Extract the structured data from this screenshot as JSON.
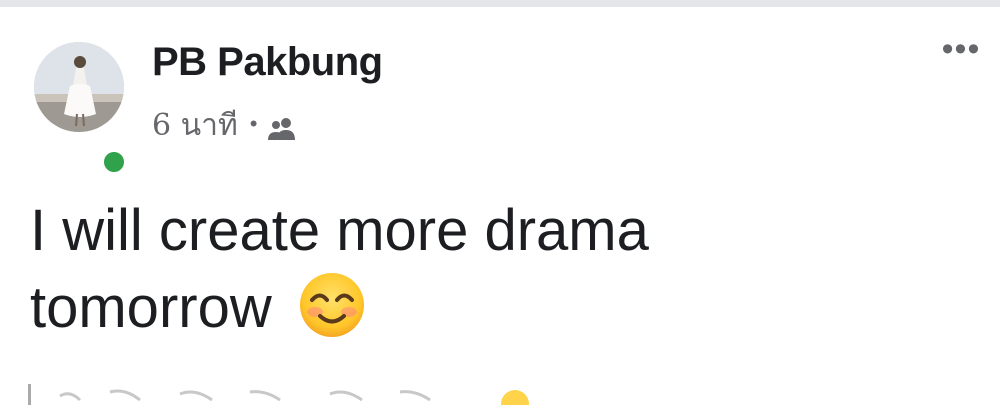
{
  "post": {
    "author": "PB Pakbung",
    "time": "6 นาที",
    "separator": "•",
    "audience_icon": "friends-icon",
    "text": "I will create more drama tomorrow",
    "emoji": "smiling-face-with-smiling-eyes",
    "more_label": "•••",
    "online": true
  },
  "colors": {
    "name": "#1c1e21",
    "meta": "#65676b",
    "online": "#31a24c",
    "divider": "#e4e6ea"
  }
}
